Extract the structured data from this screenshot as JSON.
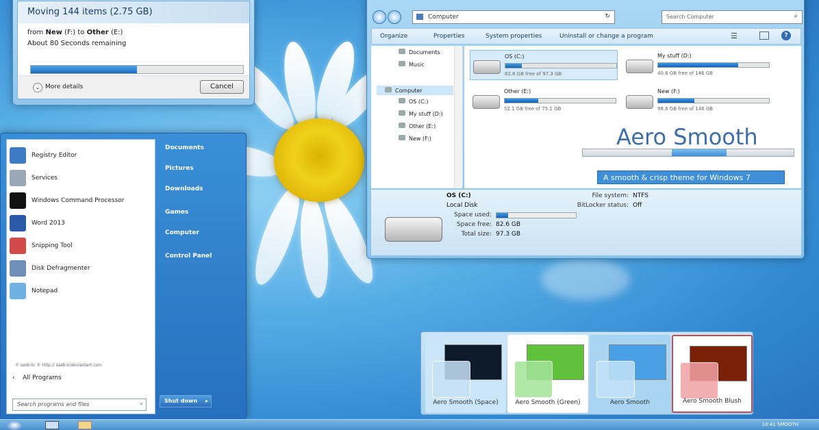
{
  "copy_dialog": {
    "title": "Moving 144 items (2.75 GB)",
    "from_prefix": "from",
    "from_bold": "New",
    "from_paren": "(F:)",
    "to_word": "to",
    "to_bold": "Other",
    "to_paren": "(E:)",
    "remaining": "About 80 Seconds remaining",
    "progress": 0.5,
    "more_details": "More details",
    "cancel": "Cancel"
  },
  "start_menu": {
    "programs": [
      {
        "label": "Registry Editor",
        "icon": "registry-icon",
        "color": "#3d7bc4"
      },
      {
        "label": "Services",
        "icon": "services-icon",
        "color": "#9aa7b5"
      },
      {
        "label": "Windows Command Processor",
        "icon": "cmd-icon",
        "color": "#111111"
      },
      {
        "label": "Word 2013",
        "icon": "word-icon",
        "color": "#2a5aa8"
      },
      {
        "label": "Snipping Tool",
        "icon": "scissors-icon",
        "color": "#d24a4a"
      },
      {
        "label": "Disk Defragmenter",
        "icon": "defrag-icon",
        "color": "#6e8fb8"
      },
      {
        "label": "Notepad",
        "icon": "notepad-icon",
        "color": "#6fb1e3"
      }
    ],
    "footer_note": "© sasb-tc ® http:// sasb-tcdeviantart.com",
    "all_programs": "All Programs",
    "search_placeholder": "Search programs and files",
    "right_items": [
      "Documents",
      "Pictures",
      "Downloads",
      "Games",
      "Computer",
      "Control Panel"
    ],
    "shutdown": "Shut down"
  },
  "explorer": {
    "address": "Computer",
    "search_placeholder": "Search Computer",
    "commands": [
      "Organize",
      "Properties",
      "System properties",
      "Uninstall or change a program"
    ],
    "nav": [
      "Documents",
      "Music",
      "Computer",
      "OS (C:)",
      "My stuff (D:)",
      "Other (E:)",
      "New (F:)"
    ],
    "drives": [
      {
        "name": "OS (C:)",
        "free": "82.6 GB free of 97.3 GB",
        "used": 0.15
      },
      {
        "name": "My stuff (D:)",
        "free": "40.6 GB free of 146 GB",
        "used": 0.72
      },
      {
        "name": "Other (E:)",
        "free": "52.1 GB free of 75.1 GB",
        "used": 0.3
      },
      {
        "name": "New (F:)",
        "free": "98.6 GB free of 146 GB",
        "used": 0.33
      }
    ],
    "watermark_title": "Aero Smooth",
    "watermark_subtitle": "A smooth & crisp theme for Windows 7",
    "details": {
      "name": "OS (C:)",
      "type": "Local Disk",
      "space_used_label": "Space used:",
      "space_used": 0.15,
      "space_free_label": "Space free:",
      "space_free": "82.6 GB",
      "total_label": "Total size:",
      "total": "97.3 GB",
      "fs_label": "File system:",
      "fs": "NTFS",
      "bitlocker_label": "BitLocker status:",
      "bitlocker": "Off"
    }
  },
  "themes": [
    {
      "label": "Aero Smooth (Space)",
      "bg": "#cbe6f8",
      "wall": "#0d1a2a",
      "glass": "#c7e1f5"
    },
    {
      "label": "Aero Smooth (Green)",
      "bg": "#ffffff",
      "wall": "#5fc23a",
      "glass": "#a4e59a"
    },
    {
      "label": "Aero Smooth",
      "bg": "#a9d5f3",
      "wall": "#4aa0e3",
      "glass": "#c3e3f9"
    },
    {
      "label": "Aero Smooth Blush",
      "bg": "#ffffff",
      "wall": "#7a2008",
      "glass": "#f2a3a6"
    }
  ],
  "taskbar": {
    "clock": "10:41 SMOOTH"
  }
}
